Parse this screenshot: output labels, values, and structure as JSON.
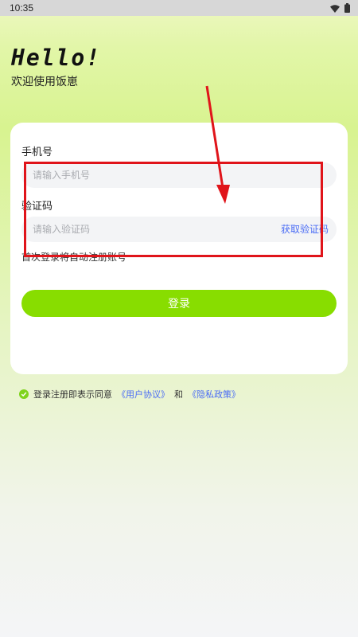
{
  "status_bar": {
    "time": "10:35",
    "icons": [
      "wifi-icon",
      "battery-icon"
    ]
  },
  "header": {
    "hello": "Hello!",
    "welcome": "欢迎使用饭崽"
  },
  "form": {
    "phone": {
      "label": "手机号",
      "placeholder": "请输入手机号",
      "value": ""
    },
    "code": {
      "label": "验证码",
      "placeholder": "请输入验证码",
      "value": "",
      "get_code_label": "获取验证码"
    },
    "hint": "首次登录将自动注册账号",
    "login_label": "登录"
  },
  "agreement": {
    "prefix": "登录注册即表示同意",
    "user_agreement": "《用户协议》",
    "and": "和",
    "privacy_policy": "《隐私政策》"
  },
  "colors": {
    "accent": "#88dd00",
    "link": "#4a6cf5",
    "annotation": "#e0141a"
  }
}
